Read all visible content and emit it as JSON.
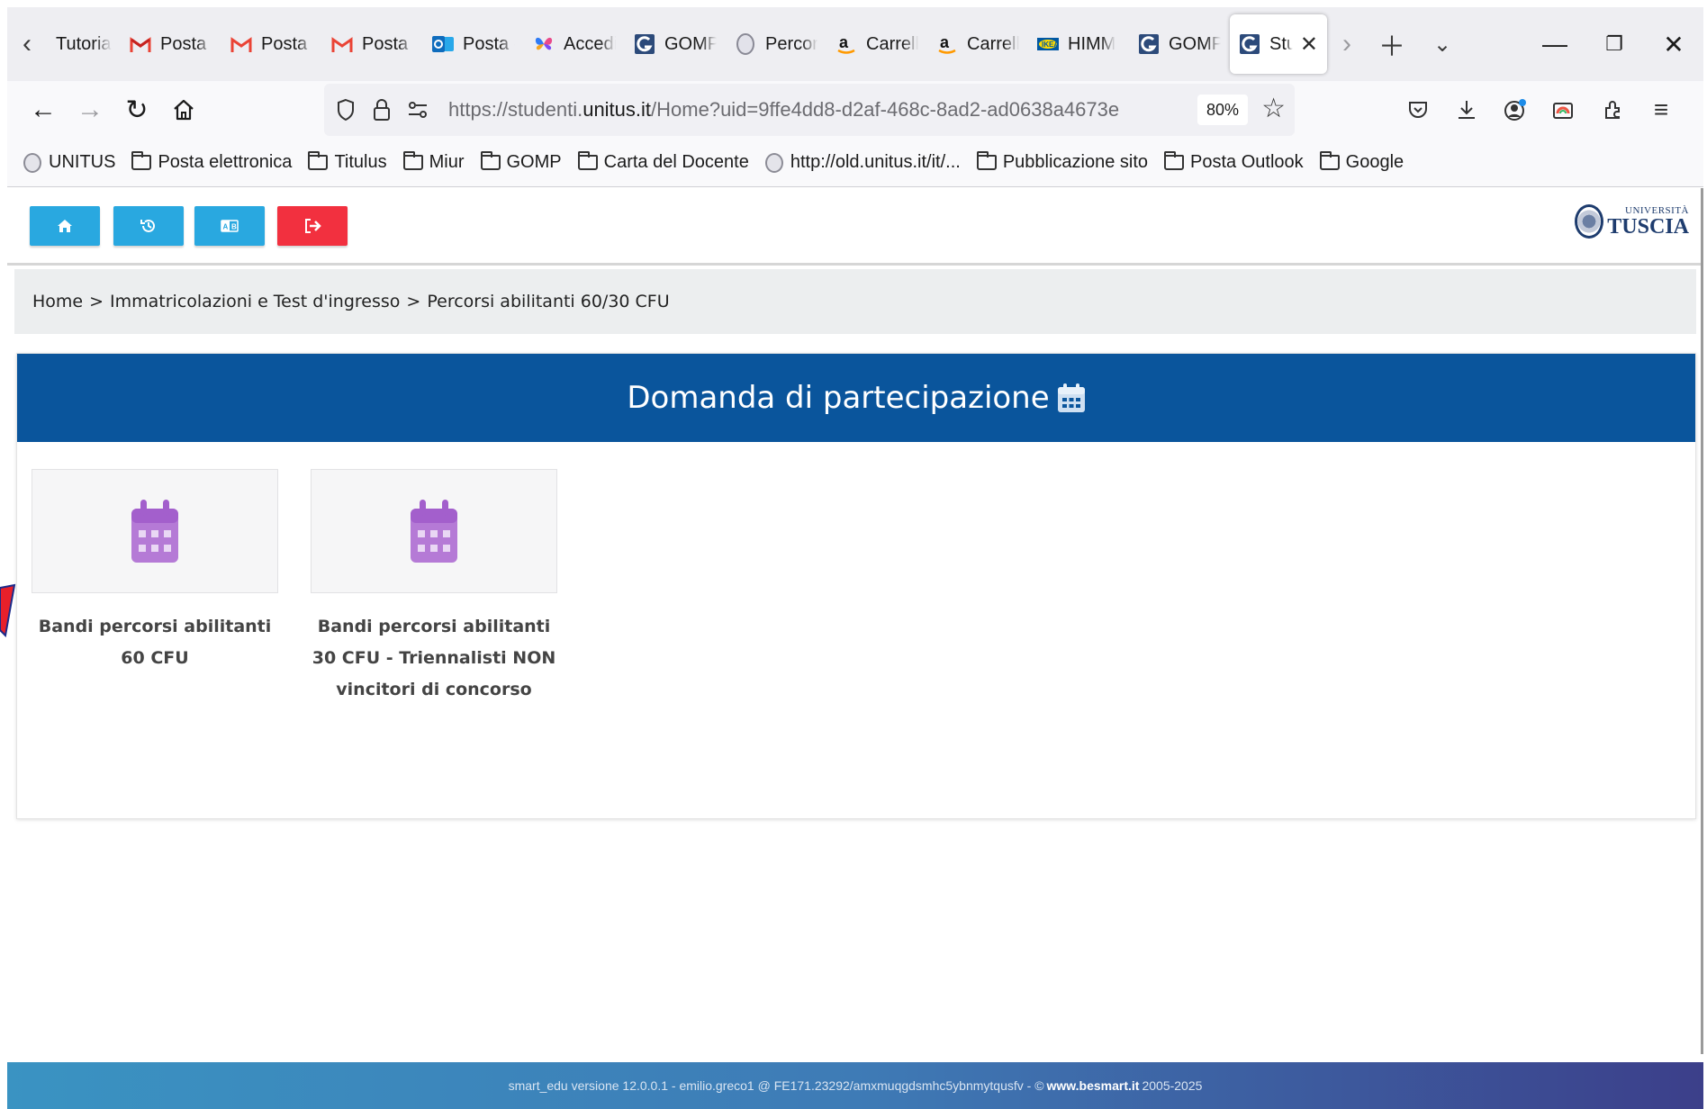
{
  "browser": {
    "tabs": [
      {
        "label": "Tutoria",
        "icon": "none"
      },
      {
        "label": "Posta i",
        "icon": "gmail"
      },
      {
        "label": "Posta i",
        "icon": "gmail"
      },
      {
        "label": "Posta i",
        "icon": "gmail"
      },
      {
        "label": "Posta -",
        "icon": "outlook"
      },
      {
        "label": "Accedi",
        "icon": "butterfly"
      },
      {
        "label": "GOMP",
        "icon": "gomp"
      },
      {
        "label": "Percor",
        "icon": "seal"
      },
      {
        "label": "Carrell",
        "icon": "amazon"
      },
      {
        "label": "Carrell",
        "icon": "amazon"
      },
      {
        "label": "HIMM",
        "icon": "ikea"
      },
      {
        "label": "GOMP",
        "icon": "gomp"
      },
      {
        "label": "Stu",
        "icon": "gomp",
        "active": true
      }
    ],
    "url": {
      "prefix": "https://studenti.",
      "domain": "unitus.it",
      "path": "/Home?uid=9ffe4dd8-d2af-468c-8ad2-ad0638a4673e"
    },
    "zoom": "80%",
    "bookmarks": [
      {
        "label": "UNITUS",
        "icon": "seal"
      },
      {
        "label": "Posta elettronica",
        "icon": "folder"
      },
      {
        "label": "Titulus",
        "icon": "folder"
      },
      {
        "label": "Miur",
        "icon": "folder"
      },
      {
        "label": "GOMP",
        "icon": "folder"
      },
      {
        "label": "Carta del Docente",
        "icon": "folder"
      },
      {
        "label": "http://old.unitus.it/it/...",
        "icon": "seal"
      },
      {
        "label": "Pubblicazione sito",
        "icon": "folder"
      },
      {
        "label": "Posta Outlook",
        "icon": "folder"
      },
      {
        "label": "Google",
        "icon": "folder"
      }
    ]
  },
  "header": {
    "logo_line1": "UNIVERSITÀ",
    "logo_line2": "TUSCIA",
    "buttons": [
      {
        "icon": "home-icon",
        "color": "#29a8e0"
      },
      {
        "icon": "history-icon",
        "color": "#29a8e0"
      },
      {
        "icon": "language-icon",
        "color": "#29a8e0"
      },
      {
        "icon": "logout-icon",
        "color": "#f2303f"
      }
    ]
  },
  "breadcrumb": {
    "home": "Home",
    "level1": "Immatricolazioni e Test d'ingresso",
    "level2": "Percorsi abilitanti 60/30 CFU",
    "separator": ">"
  },
  "main": {
    "title": "Domanda di partecipazione",
    "tiles": [
      {
        "label": "Bandi percorsi abilitanti 60 CFU"
      },
      {
        "label": "Bandi percorsi abilitanti 30 CFU - Triennalisti NON vincitori di concorso"
      }
    ]
  },
  "footer": {
    "text": "smart_edu versione 12.0.0.1 - emilio.greco1 @ FE171.23292/amxmuqgdsmhc5ybnmytqusfv - ©",
    "link": "www.besmart.it",
    "years": "2005-2025"
  },
  "colors": {
    "header_blue": "#0a559c",
    "button_blue": "#29a8e0",
    "button_red": "#f2303f",
    "tile_icon": "#b57ad6"
  }
}
